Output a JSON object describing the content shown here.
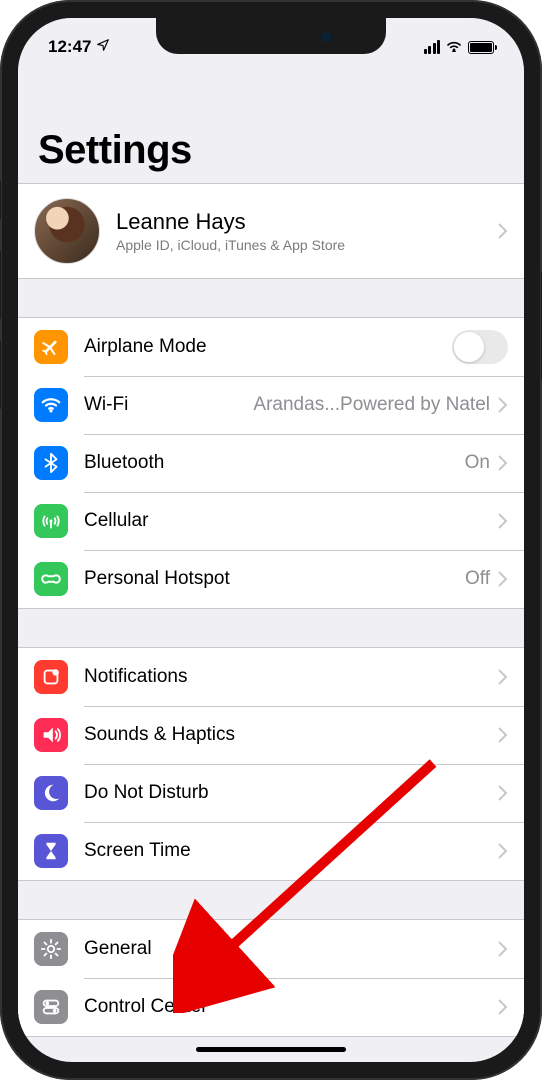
{
  "status": {
    "time": "12:47"
  },
  "page": {
    "title": "Settings"
  },
  "profile": {
    "name": "Leanne Hays",
    "subtitle": "Apple ID, iCloud, iTunes & App Store"
  },
  "group1": {
    "airplane": {
      "label": "Airplane Mode",
      "icon_color": "#ff9500"
    },
    "wifi": {
      "label": "Wi-Fi",
      "value": "Arandas...Powered by Natel",
      "icon_color": "#007aff"
    },
    "bluetooth": {
      "label": "Bluetooth",
      "value": "On",
      "icon_color": "#007aff"
    },
    "cellular": {
      "label": "Cellular",
      "icon_color": "#34c759"
    },
    "hotspot": {
      "label": "Personal Hotspot",
      "value": "Off",
      "icon_color": "#34c759"
    }
  },
  "group2": {
    "notifications": {
      "label": "Notifications",
      "icon_color": "#ff3b30"
    },
    "sounds": {
      "label": "Sounds & Haptics",
      "icon_color": "#ff2d55"
    },
    "dnd": {
      "label": "Do Not Disturb",
      "icon_color": "#5856d6"
    },
    "screentime": {
      "label": "Screen Time",
      "icon_color": "#5856d6"
    }
  },
  "group3": {
    "general": {
      "label": "General",
      "icon_color": "#8e8e93"
    },
    "controlcenter": {
      "label": "Control Center",
      "icon_color": "#8e8e93"
    }
  }
}
